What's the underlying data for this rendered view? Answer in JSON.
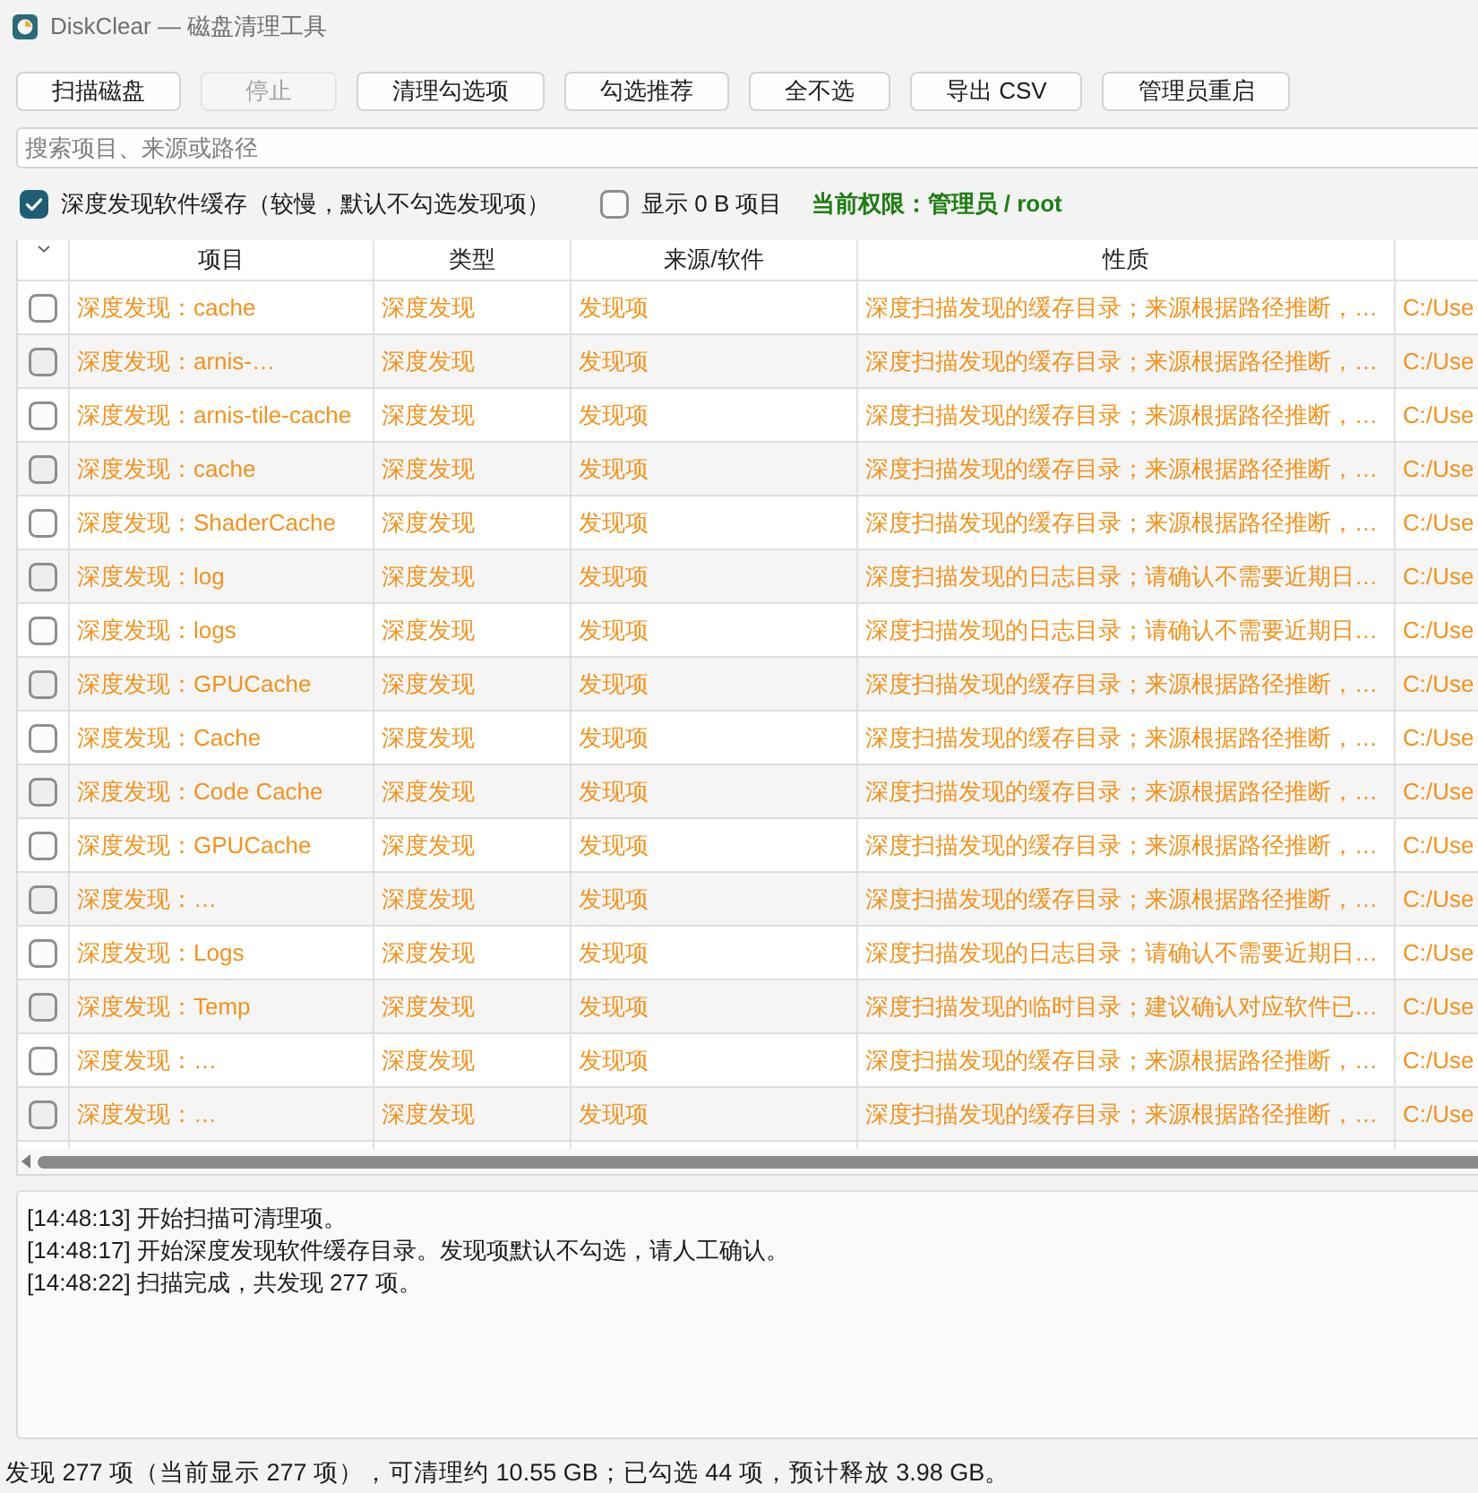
{
  "window": {
    "title": "DiskClear — 磁盘清理工具"
  },
  "toolbar": {
    "buttons": [
      {
        "label": "扫描磁盘",
        "disabled": false
      },
      {
        "label": "停止",
        "disabled": true
      },
      {
        "label": "清理勾选项",
        "disabled": false
      },
      {
        "label": "勾选推荐",
        "disabled": false
      },
      {
        "label": "全不选",
        "disabled": false
      },
      {
        "label": "导出 CSV",
        "disabled": false
      },
      {
        "label": "管理员重启",
        "disabled": false
      }
    ]
  },
  "search": {
    "placeholder": "搜索项目、来源或路径"
  },
  "options": [
    {
      "label": "深度发现软件缓存（较慢，默认不勾选发现项）",
      "checked": true
    },
    {
      "label": "显示 0 B 项目",
      "checked": false
    }
  ],
  "permission": "当前权限：管理员 / root",
  "table": {
    "columns": [
      "项目",
      "类型",
      "来源/软件",
      "性质"
    ],
    "rows": [
      {
        "checked": false,
        "item": "深度发现：cache",
        "type": "深度发现",
        "source": "发现项",
        "nature": "深度扫描发现的缓存目录；来源根据路径推断，…",
        "column_5": "C:/Use"
      },
      {
        "checked": false,
        "item": "深度发现：arnis-…",
        "type": "深度发现",
        "source": "发现项",
        "nature": "深度扫描发现的缓存目录；来源根据路径推断，…",
        "column_5": "C:/Use"
      },
      {
        "checked": false,
        "item": "深度发现：arnis-tile-cache",
        "type": "深度发现",
        "source": "发现项",
        "nature": "深度扫描发现的缓存目录；来源根据路径推断，…",
        "column_5": "C:/Use"
      },
      {
        "checked": false,
        "item": "深度发现：cache",
        "type": "深度发现",
        "source": "发现项",
        "nature": "深度扫描发现的缓存目录；来源根据路径推断，…",
        "column_5": "C:/Use"
      },
      {
        "checked": false,
        "item": "深度发现：ShaderCache",
        "type": "深度发现",
        "source": "发现项",
        "nature": "深度扫描发现的缓存目录；来源根据路径推断，…",
        "column_5": "C:/Use"
      },
      {
        "checked": false,
        "item": "深度发现：log",
        "type": "深度发现",
        "source": "发现项",
        "nature": "深度扫描发现的日志目录；请确认不需要近期日…",
        "column_5": "C:/Use"
      },
      {
        "checked": false,
        "item": "深度发现：logs",
        "type": "深度发现",
        "source": "发现项",
        "nature": "深度扫描发现的日志目录；请确认不需要近期日…",
        "column_5": "C:/Use"
      },
      {
        "checked": false,
        "item": "深度发现：GPUCache",
        "type": "深度发现",
        "source": "发现项",
        "nature": "深度扫描发现的缓存目录；来源根据路径推断，…",
        "column_5": "C:/Use"
      },
      {
        "checked": false,
        "item": "深度发现：Cache",
        "type": "深度发现",
        "source": "发现项",
        "nature": "深度扫描发现的缓存目录；来源根据路径推断，…",
        "column_5": "C:/Use"
      },
      {
        "checked": false,
        "item": "深度发现：Code Cache",
        "type": "深度发现",
        "source": "发现项",
        "nature": "深度扫描发现的缓存目录；来源根据路径推断，…",
        "column_5": "C:/Use"
      },
      {
        "checked": false,
        "item": "深度发现：GPUCache",
        "type": "深度发现",
        "source": "发现项",
        "nature": "深度扫描发现的缓存目录；来源根据路径推断，…",
        "column_5": "C:/Use"
      },
      {
        "checked": false,
        "item": "深度发现：…",
        "type": "深度发现",
        "source": "发现项",
        "nature": "深度扫描发现的缓存目录；来源根据路径推断，…",
        "column_5": "C:/Use"
      },
      {
        "checked": false,
        "item": "深度发现：Logs",
        "type": "深度发现",
        "source": "发现项",
        "nature": "深度扫描发现的日志目录；请确认不需要近期日…",
        "column_5": "C:/Use"
      },
      {
        "checked": false,
        "item": "深度发现：Temp",
        "type": "深度发现",
        "source": "发现项",
        "nature": "深度扫描发现的临时目录；建议确认对应软件已…",
        "column_5": "C:/Use"
      },
      {
        "checked": false,
        "item": "深度发现：…",
        "type": "深度发现",
        "source": "发现项",
        "nature": "深度扫描发现的缓存目录；来源根据路径推断，…",
        "column_5": "C:/Use"
      },
      {
        "checked": false,
        "item": "深度发现：…",
        "type": "深度发现",
        "source": "发现项",
        "nature": "深度扫描发现的缓存目录；来源根据路径推断，…",
        "column_5": "C:/Use"
      }
    ]
  },
  "log": [
    "[14:48:13] 开始扫描可清理项。",
    "[14:48:17] 开始深度发现软件缓存目录。发现项默认不勾选，请人工确认。",
    "[14:48:22] 扫描完成，共发现 277 项。"
  ],
  "status_bar": "发现 277 项（当前显示 277 项），可清理约 10.55 GB；已勾选 44 项，预计释放 3.98 GB。"
}
